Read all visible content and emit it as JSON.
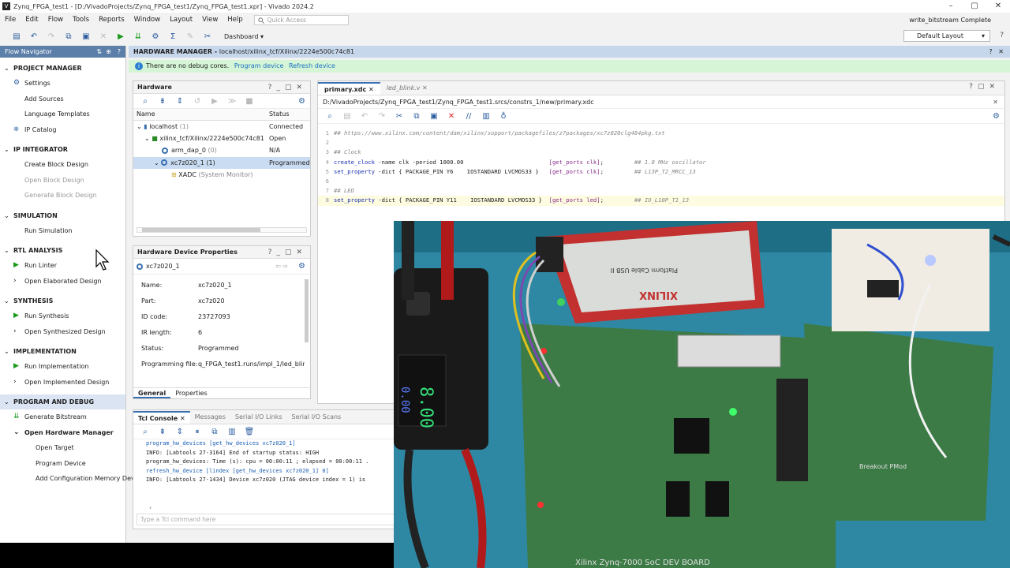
{
  "window": {
    "title": "Zynq_FPGA_test1 - [D:/VivadoProjects/Zynq_FPGA_test1/Zynq_FPGA_test1.xpr] - Vivado 2024.2"
  },
  "menu": [
    "File",
    "Edit",
    "Flow",
    "Tools",
    "Reports",
    "Window",
    "Layout",
    "View",
    "Help"
  ],
  "quick_access": "Quick Access",
  "status": "write_bitstream Complete",
  "toolbar": {
    "dashboard": "Dashboard",
    "layout": "Default Layout"
  },
  "flow_navigator": {
    "title": "Flow Navigator",
    "sections": [
      {
        "label": "PROJECT MANAGER",
        "items": [
          {
            "label": "Settings",
            "icon": "gear-icon"
          },
          {
            "label": "Add Sources"
          },
          {
            "label": "Language Templates"
          },
          {
            "label": "IP Catalog",
            "icon": "ip-icon"
          }
        ]
      },
      {
        "label": "IP INTEGRATOR",
        "items": [
          {
            "label": "Create Block Design"
          },
          {
            "label": "Open Block Design",
            "disabled": true
          },
          {
            "label": "Generate Block Design",
            "disabled": true
          }
        ]
      },
      {
        "label": "SIMULATION",
        "items": [
          {
            "label": "Run Simulation"
          }
        ]
      },
      {
        "label": "RTL ANALYSIS",
        "items": [
          {
            "label": "Run Linter",
            "icon": "play-icon"
          },
          {
            "label": "Open Elaborated Design",
            "icon": "chevron-right-icon"
          }
        ]
      },
      {
        "label": "SYNTHESIS",
        "items": [
          {
            "label": "Run Synthesis",
            "icon": "play-icon"
          },
          {
            "label": "Open Synthesized Design",
            "icon": "chevron-right-icon"
          }
        ]
      },
      {
        "label": "IMPLEMENTATION",
        "items": [
          {
            "label": "Run Implementation",
            "icon": "play-icon"
          },
          {
            "label": "Open Implemented Design",
            "icon": "chevron-right-icon"
          }
        ]
      },
      {
        "label": "PROGRAM AND DEBUG",
        "active": true,
        "items": [
          {
            "label": "Generate Bitstream",
            "icon": "bitstream-icon"
          },
          {
            "label": "Open Hardware Manager",
            "icon": "chevron-down-icon",
            "bold": true
          },
          {
            "label": "Open Target",
            "sub": true
          },
          {
            "label": "Program Device",
            "sub": true
          },
          {
            "label": "Add Configuration Memory Device",
            "sub": true
          }
        ]
      }
    ]
  },
  "hardware_manager": {
    "title": "HARDWARE MANAGER",
    "target": "localhost/xilinx_tcf/Xilinx/2224e500c74c81",
    "banner": {
      "text": "There are no debug cores.",
      "program": "Program device",
      "refresh": "Refresh device"
    }
  },
  "hardware": {
    "title": "Hardware",
    "columns": [
      "Name",
      "Status"
    ],
    "rows": [
      {
        "name": "localhost",
        "count": "(1)",
        "status": "Connected"
      },
      {
        "name": "xilinx_tcf/Xilinx/2224e500c74c81",
        "status": "Open"
      },
      {
        "name": "arm_dap_0",
        "count": "(0)",
        "status": "N/A"
      },
      {
        "name": "xc7z020_1",
        "count": "(1)",
        "status": "Programmed"
      },
      {
        "name": "XADC",
        "count": "(System Monitor)",
        "status": ""
      }
    ]
  },
  "device_props": {
    "title": "Hardware Device Properties",
    "device": "xc7z020_1",
    "props": [
      {
        "k": "Name:",
        "v": "xc7z020_1"
      },
      {
        "k": "Part:",
        "v": "xc7z020"
      },
      {
        "k": "ID code:",
        "v": "23727093"
      },
      {
        "k": "IR length:",
        "v": "6"
      },
      {
        "k": "Status:",
        "v": "Programmed"
      },
      {
        "k": "Programming file:",
        "v": "q_FPGA_test1.runs/impl_1/led_blin"
      }
    ],
    "tabs": [
      "General",
      "Properties"
    ]
  },
  "editor": {
    "tabs": [
      "primary.xdc",
      "led_blink.v"
    ],
    "path": "D:/VivadoProjects/Zynq_FPGA_test1/Zynq_FPGA_test1.srcs/constrs_1/new/primary.xdc",
    "lines": [
      "## https://www.xilinx.com/content/dam/xilinx/support/packagefiles/z7packages/xc7z020clg484pkg.txt",
      "",
      "## Clock",
      "create_clock -name clk -period 1000.00                         [get_ports clk];         ## 1.0 MHz oscillator",
      "set_property -dict { PACKAGE_PIN Y6    IOSTANDARD LVCMOS33 }   [get_ports clk];         ## L13P_T2_MRCC_13",
      "",
      "## LED",
      "set_property -dict { PACKAGE_PIN Y11    IOSTANDARD LVCMOS33 }  [get_ports led];         ## IO_L10P_T1_13"
    ]
  },
  "tcl": {
    "tabs": [
      "Tcl Console",
      "Messages",
      "Serial I/O Links",
      "Serial I/O Scans"
    ],
    "lines": [
      {
        "t": "program_hw_devices [get_hw_devices xc7z020_1]",
        "cmd": true
      },
      {
        "t": "INFO: [Labtools 27-3164] End of startup status: HIGH"
      },
      {
        "t": "program_hw_devices: Time (s): cpu = 00:00:11 ; elapsed = 00:00:11 ."
      },
      {
        "t": "refresh_hw_device [lindex [get_hw_devices xc7z020_1] 0]",
        "cmd": true
      },
      {
        "t": "INFO: [Labtools 27-1434] Device xc7z020 (JTAG device index = 1) is"
      }
    ],
    "placeholder": "Type a Tcl command here"
  },
  "photo": {
    "cable_brand": "XILINX",
    "cable_name": "Platform Cable USB II",
    "board_label": "Xilinx Zynq-7000 SoC DEV BOARD",
    "pmod_label": "Breakout PMod",
    "meter_v": "8.00",
    "meter_a": "0.00"
  }
}
